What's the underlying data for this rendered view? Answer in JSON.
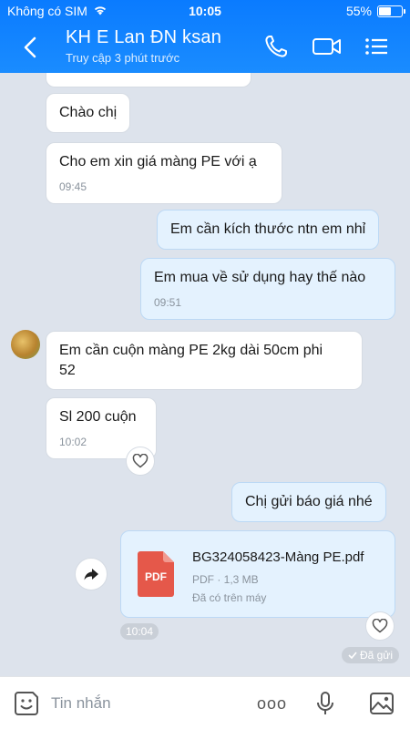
{
  "status_bar": {
    "carrier": "Không có SIM",
    "time": "10:05",
    "battery": "55%",
    "battery_level": 0.55
  },
  "header": {
    "title": "KH E Lan ĐN ksan",
    "subtitle": "Truy cập 3 phút trước",
    "icons": [
      "back-icon",
      "phone-icon",
      "video-call-icon",
      "menu-icon"
    ]
  },
  "messages": [
    {
      "dir": "in",
      "text": "Chào chị"
    },
    {
      "dir": "in",
      "text": "Cho em xin giá màng PE với ạ",
      "time": "09:45"
    },
    {
      "dir": "out",
      "text": "Em cần kích thước ntn em nhỉ"
    },
    {
      "dir": "out",
      "text": "Em mua về sử dụng hay thế nào",
      "time": "09:51"
    },
    {
      "dir": "in",
      "text_line1": "Em cần cuộn màng PE 2kg dài 50cm phi",
      "text_line2": "52"
    },
    {
      "dir": "in",
      "text": "Sl 200 cuộn",
      "time": "10:02"
    },
    {
      "dir": "out",
      "text": "Chị gửi báo giá nhé"
    }
  ],
  "file_message": {
    "icon_label": "PDF",
    "filename": "BG324058423-Màng PE.pdf",
    "meta": "PDF · 1,3 MB",
    "status": "Đã có trên máy",
    "time": "10:04"
  },
  "sent_status": "Đã gửi",
  "composer": {
    "placeholder": "Tin nhắn",
    "more_label": "ooo"
  },
  "colors": {
    "header": "#1a8cff",
    "outgoing_bubble": "#e4f2fe",
    "background": "#dde3ec",
    "pdf_red": "#e5584a"
  }
}
